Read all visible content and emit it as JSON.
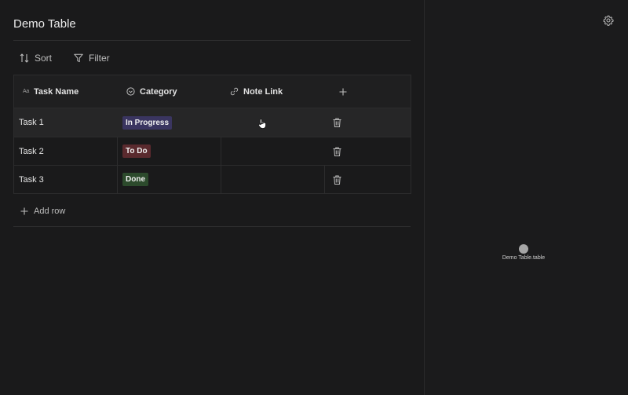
{
  "page": {
    "title": "Demo Table"
  },
  "toolbar": {
    "sort_label": "Sort",
    "filter_label": "Filter"
  },
  "table": {
    "columns": [
      {
        "label": "Task Name",
        "icon": "text-type-icon",
        "icon_text": "Aa"
      },
      {
        "label": "Category",
        "icon": "select-circle-icon"
      },
      {
        "label": "Note Link",
        "icon": "link-icon"
      },
      {
        "label": "",
        "icon": "add-column-icon"
      }
    ],
    "rows": [
      {
        "task": "Task 1",
        "category": "In Progress",
        "category_color": "#3a3560",
        "note_link": ""
      },
      {
        "task": "Task 2",
        "category": "To Do",
        "category_color": "#5a2a2e",
        "note_link": ""
      },
      {
        "task": "Task 3",
        "category": "Done",
        "category_color": "#2c4a2c",
        "note_link": ""
      }
    ],
    "add_row_label": "Add row"
  },
  "graph": {
    "node_label": "Demo Table.table"
  },
  "colors": {
    "background": "#1a1a1b",
    "row_hover": "#262627",
    "border": "#2c2c2d"
  }
}
